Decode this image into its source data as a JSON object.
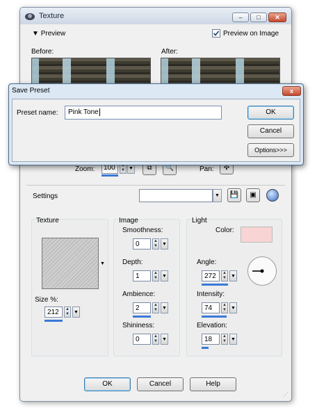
{
  "texture_window": {
    "title": "Texture",
    "preview_label": "Preview",
    "preview_on_image_label": "Preview on Image",
    "preview_on_image_checked": true,
    "before_label": "Before:",
    "after_label": "After:",
    "zoom_label": "Zoom:",
    "zoom_value": "100",
    "pan_label": "Pan:",
    "settings_label": "Settings",
    "settings_value": "",
    "texture_group": {
      "title": "Texture",
      "size_label": "Size %:",
      "size_value": "212"
    },
    "image_group": {
      "title": "Image",
      "fields": [
        {
          "label": "Smoothness:",
          "value": "0"
        },
        {
          "label": "Depth:",
          "value": "1"
        },
        {
          "label": "Ambience:",
          "value": "2"
        },
        {
          "label": "Shininess:",
          "value": "0"
        }
      ]
    },
    "light_group": {
      "title": "Light",
      "color_label": "Color:",
      "color_value": "#f8d4d4",
      "fields": [
        {
          "label": "Angle:",
          "value": "272"
        },
        {
          "label": "Intensity:",
          "value": "74"
        },
        {
          "label": "Elevation:",
          "value": "18"
        }
      ]
    },
    "buttons": {
      "ok": "OK",
      "cancel": "Cancel",
      "help": "Help"
    }
  },
  "save_preset_dialog": {
    "title": "Save Preset",
    "close_glyph": "x",
    "preset_name_label": "Preset name:",
    "preset_name_value": "Pink Tone",
    "buttons": {
      "ok": "OK",
      "cancel": "Cancel",
      "options": "Options>>>"
    }
  },
  "icons": [
    "app-icon",
    "minimize-icon",
    "maximize-icon",
    "close-icon",
    "triangle-down-icon",
    "checkbox-icon",
    "proof-icon",
    "zoom-tool-icon",
    "pan-move-icon",
    "save-preset-icon",
    "delete-preset-icon",
    "reset-icon",
    "angle-dial-icon"
  ],
  "colors": {
    "accent_blue": "#3a78d8",
    "dialog_title_bg": "#dce8f4",
    "close_red": "#c6482d",
    "light_color": "#f8d4d4"
  }
}
